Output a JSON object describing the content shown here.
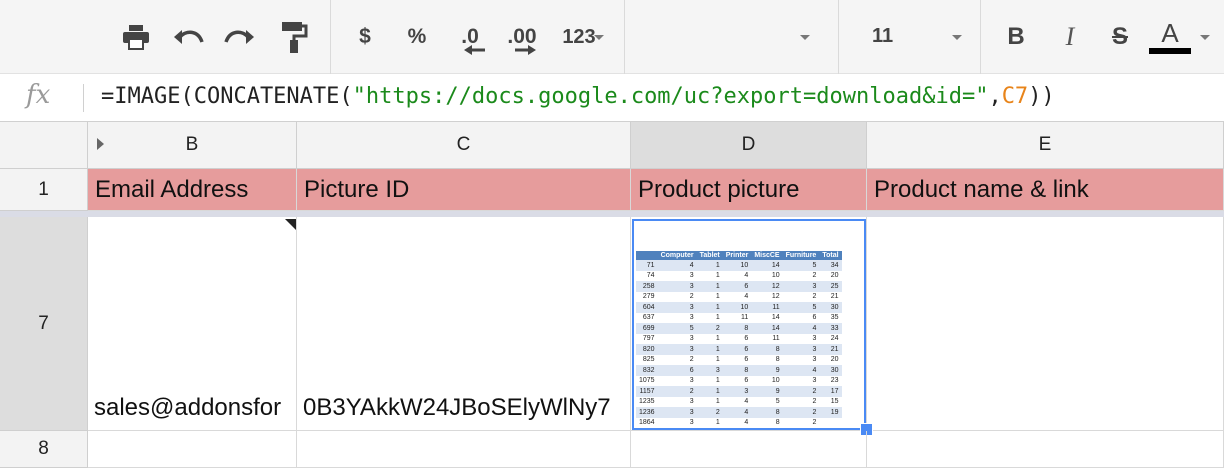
{
  "toolbar": {
    "icons": [
      "print-icon",
      "undo-icon",
      "redo-icon",
      "paint-format-icon"
    ],
    "currency_label": "$",
    "percent_label": "%",
    "decrease_decimals_label": ".0",
    "increase_decimals_label": ".00",
    "more_formats_label": "123",
    "font_name": "",
    "font_size": "11",
    "bold_label": "B",
    "italic_label": "I",
    "strike_label": "S",
    "text_color_label": "A",
    "text_color": "#000000"
  },
  "formula_bar": {
    "fx_label": "fx",
    "prefix": "=IMAGE(CONCATENATE(",
    "string_arg": "\"https://docs.google.com/uc?export=download&id=\"",
    "comma": ",",
    "ref_arg": "C7",
    "suffix": "))"
  },
  "columns": [
    "B",
    "C",
    "D",
    "E"
  ],
  "rows": [
    "1",
    "7",
    "8"
  ],
  "header_row": {
    "b": "Email Address",
    "c": "Picture ID",
    "d": "Product picture",
    "e": "Product name & link"
  },
  "row7": {
    "b": "sales@addonsfor",
    "c": "0B3YAkkW24JBoSElyWlNy7"
  },
  "colors": {
    "header_fill": "#e69c9c",
    "selection_blue": "#4a8af4",
    "formula_string": "#1b8a1b",
    "formula_ref": "#e8841a"
  },
  "image_table": {
    "headers": [
      "",
      "Computer",
      "Tablet",
      "Printer",
      "MiscCE",
      "Furniture",
      "Total"
    ],
    "rows": [
      [
        "71",
        "4",
        "1",
        "10",
        "14",
        "5",
        "34"
      ],
      [
        "74",
        "3",
        "1",
        "4",
        "10",
        "2",
        "20"
      ],
      [
        "258",
        "3",
        "1",
        "6",
        "12",
        "3",
        "25"
      ],
      [
        "279",
        "2",
        "1",
        "4",
        "12",
        "2",
        "21"
      ],
      [
        "604",
        "3",
        "1",
        "10",
        "11",
        "5",
        "30"
      ],
      [
        "637",
        "3",
        "1",
        "11",
        "14",
        "6",
        "35"
      ],
      [
        "699",
        "5",
        "2",
        "8",
        "14",
        "4",
        "33"
      ],
      [
        "797",
        "3",
        "1",
        "6",
        "11",
        "3",
        "24"
      ],
      [
        "820",
        "3",
        "1",
        "6",
        "8",
        "3",
        "21"
      ],
      [
        "825",
        "2",
        "1",
        "6",
        "8",
        "3",
        "20"
      ],
      [
        "832",
        "6",
        "3",
        "8",
        "9",
        "4",
        "30"
      ],
      [
        "1075",
        "3",
        "1",
        "6",
        "10",
        "3",
        "23"
      ],
      [
        "1157",
        "2",
        "1",
        "3",
        "9",
        "2",
        "17"
      ],
      [
        "1235",
        "3",
        "1",
        "4",
        "5",
        "2",
        "15"
      ],
      [
        "1236",
        "3",
        "2",
        "4",
        "8",
        "2",
        "19"
      ],
      [
        "1864",
        "3",
        "1",
        "4",
        "8",
        "2",
        ""
      ]
    ]
  }
}
